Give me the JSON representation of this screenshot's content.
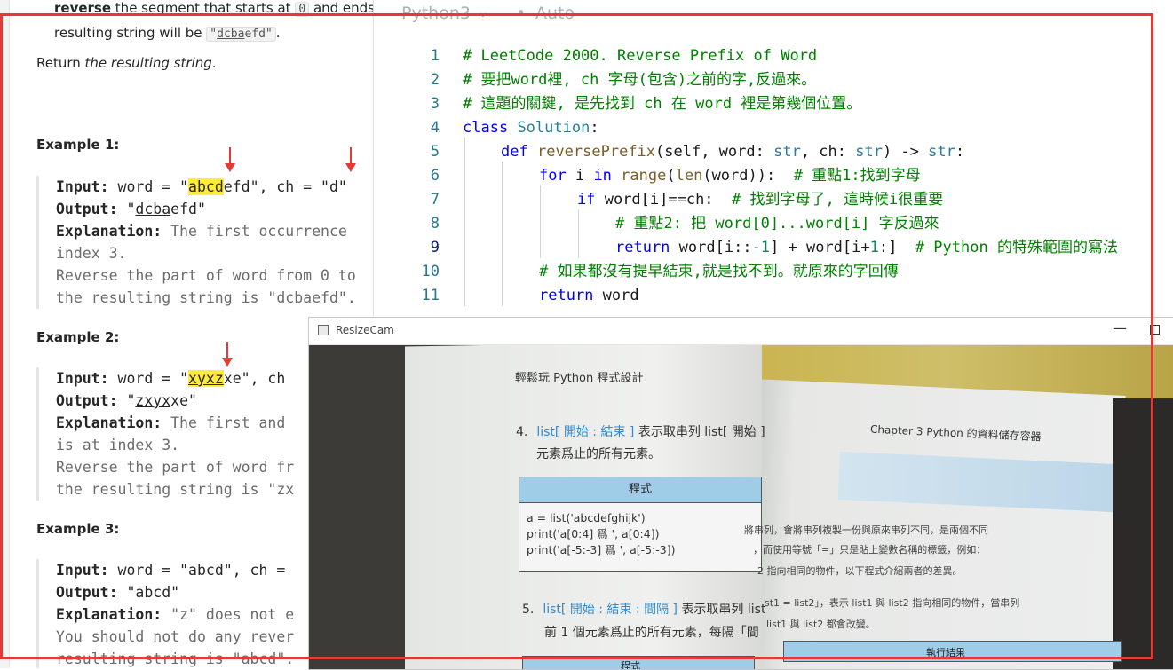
{
  "description": {
    "top_line_1_bold": "reverse",
    "top_line_1_rest": " the segment that starts at ",
    "top_line_1_code": "0",
    "top_line_1_tail": " and ends",
    "top_line_2_prefix": "resulting string will be ",
    "top_line_2_code_u": "dcba",
    "top_line_2_code_rest": "efd",
    "top_line_2_suffix": ".",
    "return_prefix": "Return ",
    "return_italic": "the resulting string",
    "return_suffix": "."
  },
  "examples": [
    {
      "title": "Example 1:",
      "input_label": "Input:",
      "input_pre": " word = \"",
      "input_hl": "abcd",
      "input_post": "efd\", ch = \"d\"",
      "output_label": "Output:",
      "output_pre": " \"",
      "output_u": "dcba",
      "output_post": "efd\"",
      "explanation_label": "Explanation:",
      "explanation_text": " The first occurrence",
      "line4": "index 3.",
      "line5": "Reverse the part of word from 0 to",
      "line6": "the resulting string is \"dcbaefd\"."
    },
    {
      "title": "Example 2:",
      "input_label": "Input:",
      "input_pre": " word = \"",
      "input_hl": "xyxz",
      "input_post": "xe\", ch",
      "output_label": "Output:",
      "output_pre": " \"",
      "output_u": "zxyx",
      "output_post": "xe\"",
      "explanation_label": "Explanation:",
      "explanation_text": " The first and",
      "line4": "is at index 3.",
      "line5": "Reverse the part of word fr",
      "line6": "the resulting string is \"zx"
    },
    {
      "title": "Example 3:",
      "input_label": "Input:",
      "input_text": " word = \"abcd\", ch = ",
      "output_label": "Output:",
      "output_text": " \"abcd\"",
      "explanation_label": "Explanation:",
      "explanation_text": " \"z\" does not e",
      "line4": "You should not do any rever",
      "line5": "resulting string is \"abcd\"."
    }
  ],
  "editor": {
    "language": "Python3",
    "language_chevron": "⌄",
    "dot": "•",
    "autosave": "Auto",
    "lines": [
      {
        "n": "1",
        "text": "# LeetCode 2000. Reverse Prefix of Word"
      },
      {
        "n": "2",
        "text": "# 要把word裡, ch 字母(包含)之前的字,反過來。"
      },
      {
        "n": "3",
        "text": "# 這題的關鍵, 是先找到 ch 在 word 裡是第幾個位置。"
      },
      {
        "n": "4",
        "kw": "class",
        "rest": " ",
        "cls": "Solution",
        "tail": ":"
      },
      {
        "n": "5",
        "kw": "def",
        "sp": " ",
        "fn": "reversePrefix",
        "args_1": "(self, word: ",
        "t1": "str",
        "args_2": ", ch: ",
        "t2": "str",
        "args_3": ") -> ",
        "t3": "str",
        "tail": ":"
      },
      {
        "n": "6",
        "kw": "for",
        "a": " i ",
        "kw2": "in",
        "sp": " ",
        "fn": "range",
        "b": "(",
        "fn2": "len",
        "c": "(word)):  ",
        "com": "# 重點1:找到字母"
      },
      {
        "n": "7",
        "kw": "if",
        "a": " word[i]==ch:  ",
        "com": "# 找到字母了, 這時候i很重要"
      },
      {
        "n": "8",
        "com": "# 重點2: 把 word[0]...word[i] 字反過來"
      },
      {
        "n": "9",
        "kw": "return",
        "a": " word[i::-",
        "num": "1",
        "b": "] + word[i+",
        "num2": "1",
        "c": ":]  ",
        "com": "# Python 的特殊範圍的寫法"
      },
      {
        "n": "10",
        "com": "# 如果都沒有提早結束,就是找不到。就原來的字回傳"
      },
      {
        "n": "11",
        "kw": "return",
        "a": " word"
      }
    ]
  },
  "camera_window": {
    "title": "ResizeCam",
    "minimize": "—",
    "book": {
      "left_header": "輕鬆玩 Python 程式設計",
      "right_header": "Chapter 3   Python 的資料儲存容器",
      "item4_num": "4.",
      "item4_blue": "list[ 開始 : 結束 ]",
      "item4_rest": " 表示取串列 list[ 開始 ]",
      "item4_line2": "元素爲止的所有元素。",
      "table_header": "程式",
      "table_code": "a = list('abcdefghijk')\nprint('a[0:4] 爲 ', a[0:4])\nprint('a[-5:-3] 爲 ', a[-5:-3])",
      "item5_num": "5.",
      "item5_blue": "list[ 開始 : 結束 : 間隔 ]",
      "item5_rest": " 表示取串列 list",
      "item5_line2": "前 1 個元素爲止的所有元素，每隔「間",
      "right_p1": "將串列，會將串列複製一份與原來串列不同，是兩個不同",
      "right_p2": "，而使用等號「=」只是貼上變數名稱的標籤，例如：",
      "right_p3": "2 指向相同的物件，以下程式介紹兩者的差異。",
      "right_p4": "st1 = list2」，表示 list1 與 list2 指向相同的物件，當串列",
      "right_p5": "list1 與 list2 都會改變。",
      "right_table_header": "執行結果",
      "bottom_table_header": "程式"
    }
  },
  "colors": {
    "annotation_red": "#e53935",
    "highlight_yellow": "#ffeb3b",
    "comment_green": "#008000",
    "keyword_blue": "#0000ff",
    "line_number": "#237893"
  }
}
